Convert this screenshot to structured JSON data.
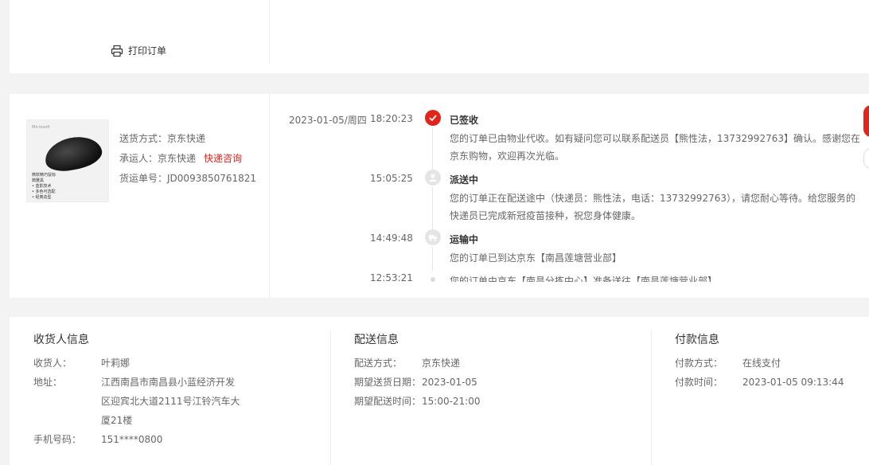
{
  "top": {
    "print_label": "打印订单"
  },
  "shipment": {
    "method_label": "送货方式：",
    "method_value": "京东快递",
    "carrier_label": "承运人：",
    "carrier_value": "京东快递",
    "consult_link": "快递咨询",
    "tracking_label": "货运单号：",
    "tracking_value": "JD0093850761821"
  },
  "product_image": {
    "brand": "Microsoft",
    "caption_lines": [
      "微软精巧鼠标",
      "典雅黑",
      "• 蓝影技术",
      "• 多色可选配",
      "• 经典造型"
    ]
  },
  "timeline": [
    {
      "date": "2023-01-05/周四",
      "time": "18:20:23",
      "status": "已签收",
      "icon": "check-icon",
      "desc": "您的订单已由物业代收。如有疑问您可以联系配送员【熊性法，13732992763】确认。感谢您在京东购物，欢迎再次光临。"
    },
    {
      "date": "",
      "time": "15:05:25",
      "status": "派送中",
      "icon": "courier-icon",
      "desc": "您的订单正在配送途中（快递员：熊性法，电话：13732992763），请您耐心等待。给您服务的快递员已完成新冠疫苗接种，祝您身体健康。"
    },
    {
      "date": "",
      "time": "14:49:48",
      "status": "运输中",
      "icon": "truck-icon",
      "desc": "您的订单已到达京东【南昌莲塘营业部】"
    },
    {
      "date": "",
      "time": "12:53:21",
      "status": "",
      "icon": "dot",
      "desc": "您的订单由京东【南昌分拣中心】准备送往【南昌莲塘营业部】"
    }
  ],
  "receiver": {
    "title": "收货人信息",
    "name_label": "收货人：",
    "name_value": "叶莉娜",
    "address_label": "地址：",
    "address_lines": [
      "江西南昌市南昌县小蓝经济开发",
      "区迎宾北大道2111号江铃汽车大",
      "厦21楼"
    ],
    "phone_label": "手机号码：",
    "phone_value": "151****0800"
  },
  "delivery": {
    "title": "配送信息",
    "method_label": "配送方式：",
    "method_value": "京东快递",
    "date_label": "期望送货日期：",
    "date_value": "2023-01-05",
    "time_label": "期望配送时间：",
    "time_value": "15:00-21:00"
  },
  "payment": {
    "title": "付款信息",
    "method_label": "付款方式：",
    "method_value": "在线支付",
    "time_label": "付款时间：",
    "time_value": "2023-01-05 09:13:44"
  },
  "colors": {
    "accent": "#e1251b",
    "text": "#666666",
    "heading": "#333333",
    "background": "#f3f3f3"
  }
}
